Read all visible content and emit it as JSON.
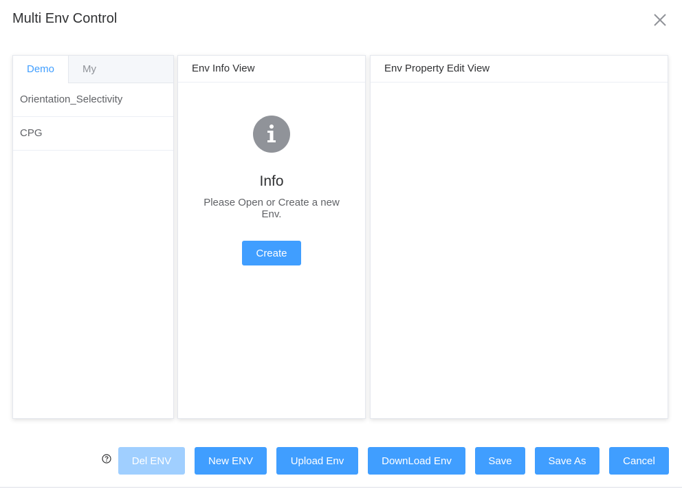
{
  "dialog": {
    "title": "Multi Env Control"
  },
  "left": {
    "tabs": [
      {
        "label": "Demo",
        "active": true
      },
      {
        "label": "My",
        "active": false
      }
    ],
    "items": [
      {
        "label": "Orientation_Selectivity"
      },
      {
        "label": "CPG"
      }
    ]
  },
  "info_view": {
    "header": "Env Info View",
    "icon": "info-icon",
    "title": "Info",
    "message": "Please Open or Create a new Env.",
    "create_label": "Create"
  },
  "property_view": {
    "header": "Env Property Edit View"
  },
  "footer": {
    "help_icon": "question-circle-icon",
    "del_env": "Del ENV",
    "new_env": "New ENV",
    "upload_env": "Upload Env",
    "download_env": "DownLoad Env",
    "save": "Save",
    "save_as": "Save As",
    "cancel": "Cancel"
  },
  "colors": {
    "primary": "#409eff",
    "disabled": "#a0cfff",
    "info_icon_bg": "#909399"
  }
}
